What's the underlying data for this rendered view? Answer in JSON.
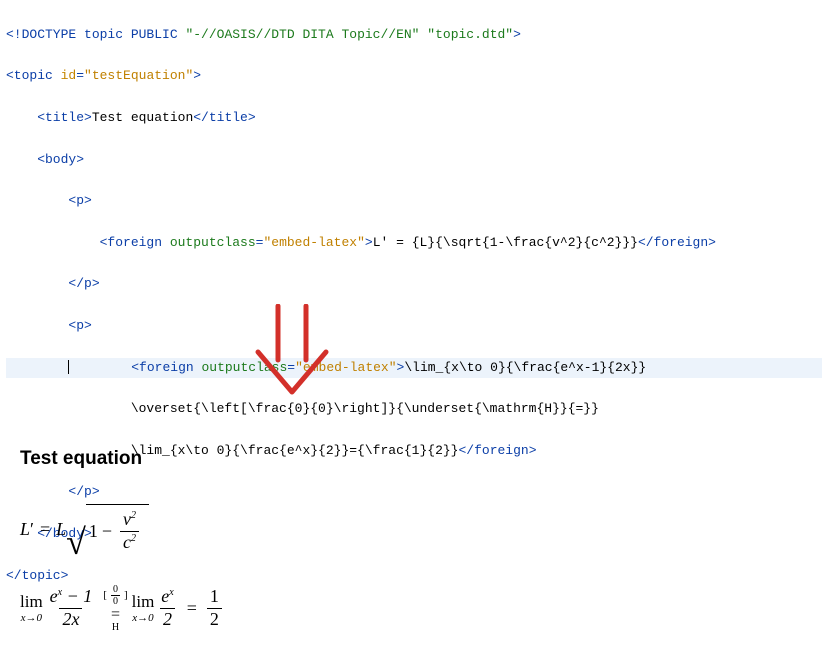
{
  "code": {
    "l1_a": "<!DOCTYPE topic PUBLIC ",
    "l1_b": "\"-//OASIS//DTD DITA Topic//EN\"",
    "l1_c": " ",
    "l1_d": "\"topic.dtd\"",
    "l1_e": ">",
    "l2_a": "<topic ",
    "l2_attr": "id",
    "l2_eq": "=",
    "l2_val": "\"testEquation\"",
    "l2_b": ">",
    "l3_o": "    <title>",
    "l3_t": "Test equation",
    "l3_c": "</title>",
    "l4": "    <body>",
    "l5": "        <p>",
    "l6_a": "            <foreign ",
    "l6_attr": "outputclass",
    "l6_eq": "=",
    "l6_val": "\"embed-latex\"",
    "l6_b": ">",
    "l6_t": "L' = {L}{\\sqrt{1-\\frac{v^2}{c^2}}}",
    "l6_c": "</foreign>",
    "l7": "        </p>",
    "l8": "        <p>",
    "l9_a": "            <foreign ",
    "l9_attr": "outputclass",
    "l9_eq": "=",
    "l9_val": "\"embed-latex\"",
    "l9_b": ">",
    "l9_t": "\\lim_{x\\to 0}{\\frac{e^x-1}{2x}}",
    "l10_t": "                \\overset{\\left[\\frac{0}{0}\\right]}{\\underset{\\mathrm{H}}{=}}",
    "l11_t": "                \\lim_{x\\to 0}{\\frac{e^x}{2}}={\\frac{1}{2}}",
    "l11_c": "</foreign>",
    "l12": "        </p>",
    "l13": "    </body>",
    "l14": "</topic>"
  },
  "rendered": {
    "title": "Test equation",
    "eq1": {
      "lhs_L": "L",
      "prime": "′",
      "eq": "=",
      "rhs_L": "L",
      "one": "1",
      "minus": "−",
      "vnum": "v",
      "v2": "2",
      "cden": "c",
      "c2": "2"
    },
    "eq2": {
      "lim": "lim",
      "xto0": "x→0",
      "e": "e",
      "x": "x",
      "minus1": "− 1",
      "twox": "2x",
      "ov0": "0",
      "eqsym": "=",
      "H": "H",
      "two": "2",
      "one": "1",
      "half2": "2",
      "lbr": "[",
      "rbr": "]"
    }
  }
}
